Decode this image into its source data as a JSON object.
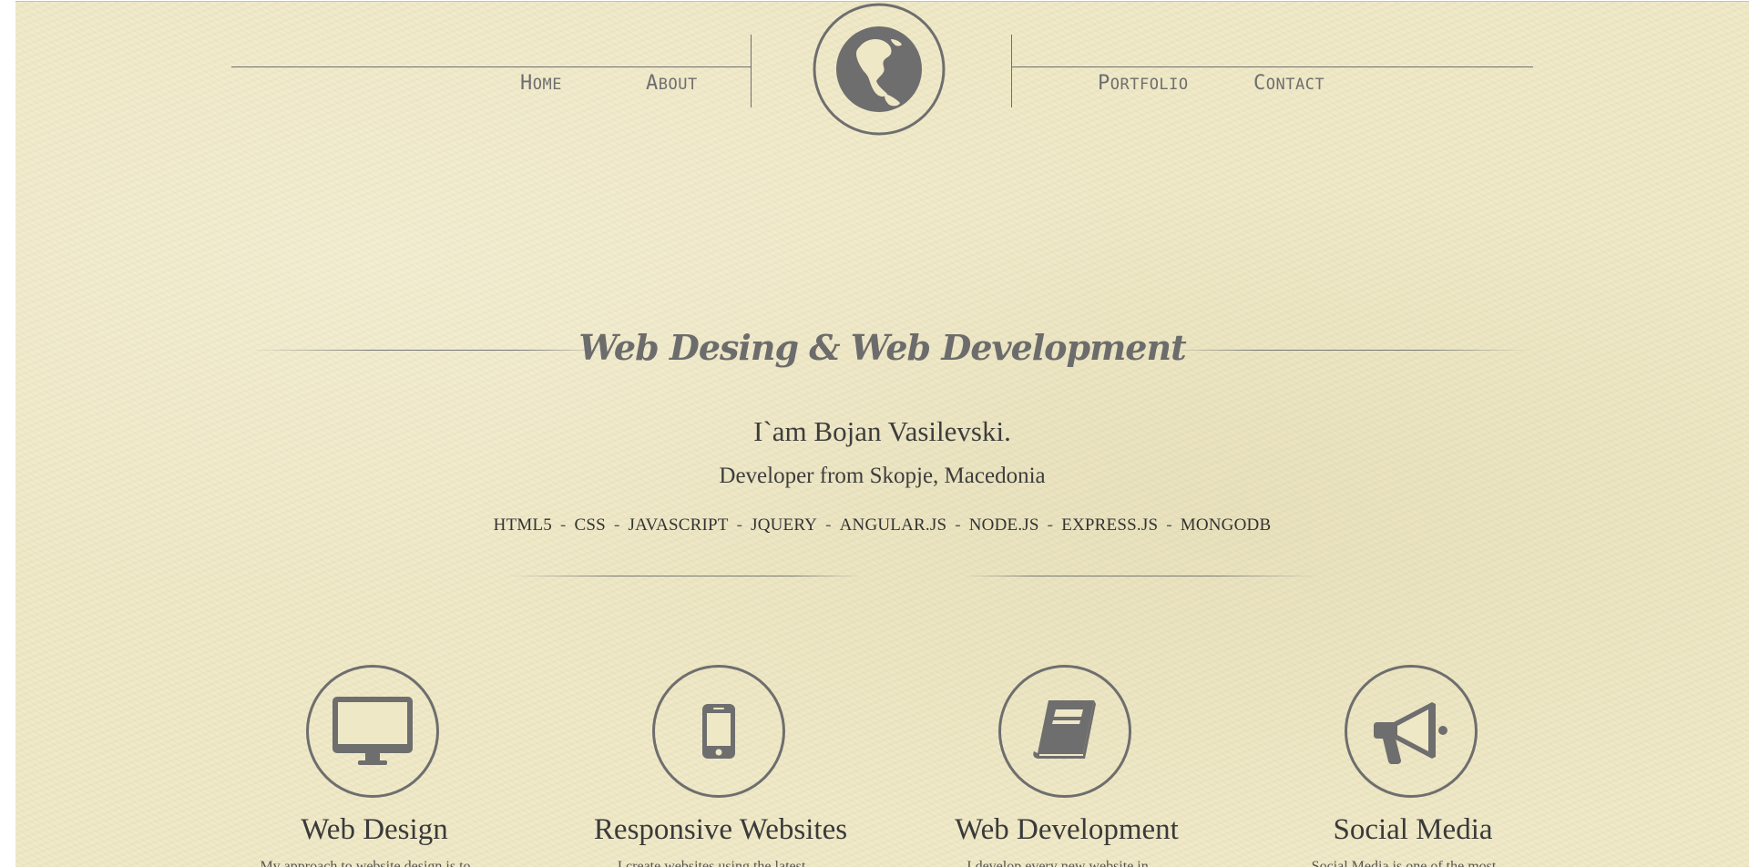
{
  "nav": {
    "left": [
      {
        "initial": "H",
        "rest": "OME"
      },
      {
        "initial": "A",
        "rest": "BOUT"
      }
    ],
    "right": [
      {
        "initial": "P",
        "rest": "ORTFOLIO"
      },
      {
        "initial": "C",
        "rest": "ONTACT"
      }
    ],
    "logo_icon": "globe-icon"
  },
  "hero": {
    "title": "Web Desing & Web Development",
    "name": "I`am Bojan Vasilevski.",
    "subtitle": "Developer from Skopje, Macedonia",
    "skills": [
      "HTML5",
      "CSS",
      "JAVASCRIPT",
      "JQUERY",
      "ANGULAR.JS",
      "NODE.JS",
      "EXPRESS.JS",
      "MONGODB"
    ],
    "separator": "-"
  },
  "services": [
    {
      "icon": "monitor-icon",
      "title": "Web Design",
      "description": "My approach to website design is to …"
    },
    {
      "icon": "mobile-phone-icon",
      "title": "Responsive Websites",
      "description": "I create websites using the latest …"
    },
    {
      "icon": "book-icon",
      "title": "Web Development",
      "description": "I develop every new website in …"
    },
    {
      "icon": "megaphone-icon",
      "title": "Social Media",
      "description": "Social Media is one of the most …"
    }
  ],
  "colors": {
    "background": "#efe8c6",
    "icon": "#6e6e6e",
    "text": "#3d3d3d"
  }
}
